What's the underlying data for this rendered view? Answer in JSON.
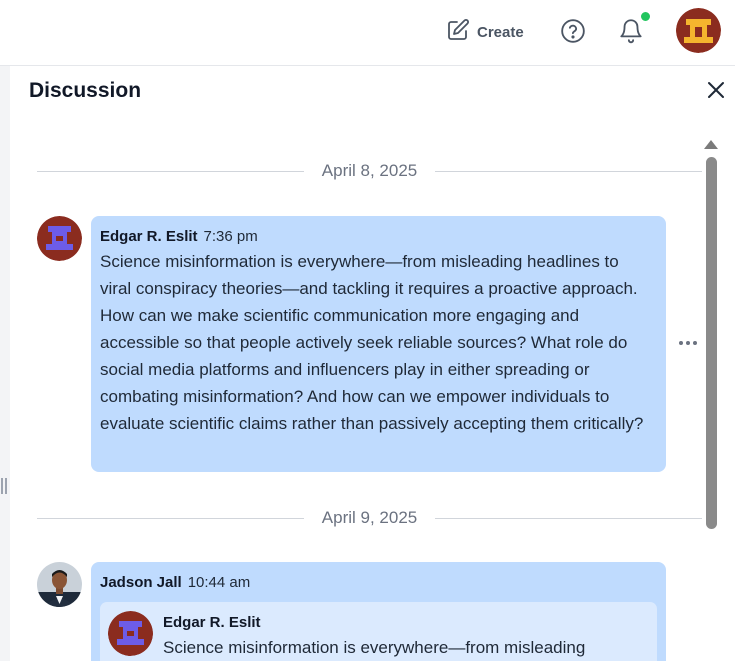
{
  "topbar": {
    "create_label": "Create",
    "icons": [
      "edit-icon",
      "help-icon",
      "bell-icon"
    ],
    "notification_dot_color": "#22c55e"
  },
  "panel": {
    "title": "Discussion"
  },
  "thread": {
    "date_1": "April 8, 2025",
    "date_2": "April 9, 2025",
    "message_1": {
      "author": "Edgar R. Eslit",
      "time": "7:36 pm",
      "text": "Science misinformation is everywhere—from misleading headlines to viral conspiracy theories—and tackling it requires a proactive approach. How can we make scientific communication more engaging and accessible so that people actively seek reliable sources? What role do social media platforms and influencers play in either spreading or combating misinformation? And how can we empower individuals to evaluate scientific claims rather than passively accepting them critically?"
    },
    "message_2": {
      "author": "Jadson Jall",
      "time": "10:44 am",
      "quoted": {
        "author": "Edgar R. Eslit",
        "text": "Science misinformation is everywhere—from misleading"
      }
    }
  },
  "colors": {
    "bubble": "#bfdbfe",
    "quote": "#dbeafe",
    "avatar_brown": "#8b2c1f",
    "avatar_purple": "#6d5ce8"
  }
}
